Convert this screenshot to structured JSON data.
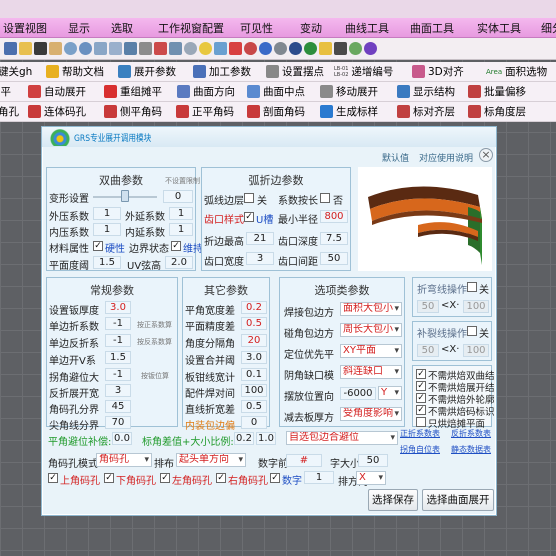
{
  "menu": [
    "设置视图",
    "显示",
    "选取",
    "工作视窗配置",
    "可见性",
    "变动",
    "曲线工具",
    "曲面工具",
    "实体工具",
    "细分"
  ],
  "toolbar1": [
    "键关gh",
    "帮助文档",
    "展开参数",
    "加工参数",
    "设置摆点",
    "递增编号",
    "3D对齐",
    "面积选物"
  ],
  "toolbar1_tags": {
    "lb01": "LB-01",
    "lb02": "LB-02",
    "area": "Area"
  },
  "toolbar2": [
    "展平",
    "自动展开",
    "重组摊平",
    "曲面方向",
    "曲面中点",
    "移动展开",
    "显示结构",
    "批量偏移"
  ],
  "toolbar3": [
    "角孔",
    "连体码孔",
    "侧平角码",
    "正平角码",
    "剖面角码",
    "生成标样",
    "标对齐层",
    "标角度层"
  ],
  "dialog": {
    "title": "GRS专业展开调用模块",
    "defaults_link": "默认值",
    "help_link": "对应使用说明"
  },
  "curve": {
    "title": "双曲参数",
    "note": "不设置限制",
    "deform": "变形设置",
    "deform_val": "0",
    "outer_x": "外压系数",
    "outer_x_val": "1",
    "outer_y": "外延系数",
    "outer_y_val": "1",
    "inner_x": "内压系数",
    "inner_x_val": "1",
    "inner_y": "内延系数",
    "inner_y_val": "1",
    "mat": "材料属性",
    "hard": "硬性",
    "edge_state": "边界状态",
    "maintain": "维持",
    "flat": "平面度阈",
    "flat_val": "1.5",
    "uv": "UV弦高",
    "uv_val": "2.0"
  },
  "arc": {
    "title": "弧折边参数",
    "arc_edge": "弧线边层",
    "off": "关",
    "coef": "系数按长",
    "no": "否",
    "notch": "齿口样式",
    "u": "U槽",
    "min_r": "最小半径",
    "min_r_val": "800",
    "fold_min": "折边最高",
    "fold_min_val": "21",
    "depth": "齿口深度",
    "depth_val": "7.5",
    "width": "齿口宽度",
    "width_val": "3",
    "gap": "齿口间距",
    "gap_val": "50"
  },
  "general": {
    "title": "常规参数",
    "r1": "设置钣厚度",
    "r1v": "3.0",
    "r2": "单边折系数",
    "r2v": "-1",
    "r2n": "按正系数算",
    "r3": "单边反折系",
    "r3v": "-1",
    "r3n": "按反系数算",
    "r4": "单边开V系",
    "r4v": "1.5",
    "r5": "拐角避位大",
    "r5v": "-1",
    "r5n": "按钣位算",
    "r6": "反折展开宽",
    "r6v": "3",
    "r7": "角码孔分界",
    "r7v": "45",
    "r8": "尖角线分界",
    "r8v": "70"
  },
  "other": {
    "title": "其它参数",
    "r1": "平角宽度差",
    "r1v": "0.2",
    "r2": "平面精度差",
    "r2v": "0.5",
    "r3": "角度分隔角",
    "r3v": "20",
    "r4": "设置合并阈",
    "r4v": "3.0",
    "r5": "板钳线宽计",
    "r5v": "0.1",
    "r6": "配件焊对间",
    "r6v": "100",
    "r7": "直线折宽差",
    "r7v": "0.5",
    "r8": "内装包边偏",
    "r8v": "0"
  },
  "options": {
    "title": "选项类参数",
    "r1": "焊接包边方",
    "r1v": "面积大包小",
    "r2": "碰角包边方",
    "r2v": "周长大包小",
    "r3": "定位优先平",
    "r3v": "XY平面",
    "r4": "阴角缺口模",
    "r4v": "斜连缺口",
    "r5": "摆放位置向",
    "r5v": "-6000",
    "r5axis": "Y",
    "r6": "减去板厚方",
    "r6v": "受角度影响"
  },
  "side": {
    "fold_title": "折弯线操作",
    "off": "关",
    "fold_a": "50",
    "x": "<X·",
    "fold_b": "100",
    "fill_title": "补裂线操作",
    "fill_a": "50",
    "fill_b": "100",
    "c1": "不需烘焙双曲结",
    "c2": "不需烘焙展开结",
    "c3": "不需烘焙外轮廓",
    "c4": "不需烘焙码标识",
    "c5": "只烘焙摊平面"
  },
  "bottom": {
    "flat_comp": "平角避位补偿:",
    "flat_comp_val": "0.0",
    "angle_diff": "标角差值+大小比例:",
    "angle_diff_v1": "0.2",
    "angle_diff_v2": "1.0",
    "auto_pos": "自选包边合避位",
    "link1": "正折系数表",
    "link2": "反折系数表",
    "corner": "角码孔模式",
    "corner_v": "角码孔",
    "arrange": "排布",
    "arrange_v": "起头单方向",
    "num_prefix": "数字前",
    "num_prefix_v": "#",
    "font": "字大小",
    "font_v": "50",
    "up": "上角码孔",
    "down": "下角码孔",
    "left": "左角码孔",
    "right": "右角码孔",
    "digit": "数字",
    "digit_v": "1",
    "order": "排方向",
    "order_v": "X",
    "link3": "拐角自位表",
    "link4": "静态数据表",
    "btn_save": "选择保存",
    "btn_run": "选择曲面展开"
  }
}
